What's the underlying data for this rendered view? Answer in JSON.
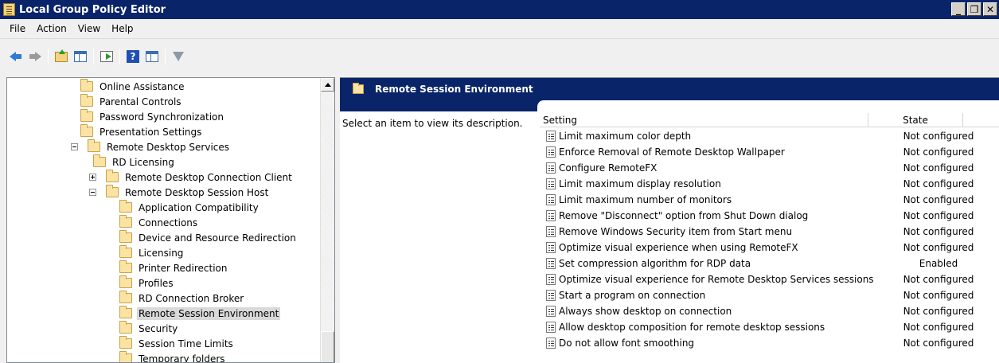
{
  "window": {
    "title": "Local Group Policy Editor",
    "controls": {
      "minimize": "_",
      "maximize": "ÿ",
      "close": "X"
    }
  },
  "menu": [
    "File",
    "Action",
    "View",
    "Help"
  ],
  "toolbar": {
    "buttons": [
      "back-icon",
      "forward-icon",
      "up-folder-icon",
      "show-hide-tree-icon",
      "export-list-icon",
      "help-icon",
      "properties-icon",
      "filter-icon"
    ]
  },
  "tree": {
    "items": [
      {
        "label": "Online Assistance",
        "level": 1
      },
      {
        "label": "Parental Controls",
        "level": 1
      },
      {
        "label": "Password Synchronization",
        "level": 1
      },
      {
        "label": "Presentation Settings",
        "level": 1
      },
      {
        "label": "Remote Desktop Services",
        "level": 1,
        "expander": "minus"
      },
      {
        "label": "RD Licensing",
        "level": 2
      },
      {
        "label": "Remote Desktop Connection Client",
        "level": 2,
        "expander": "plus"
      },
      {
        "label": "Remote Desktop Session Host",
        "level": 2,
        "expander": "minus"
      },
      {
        "label": "Application Compatibility",
        "level": 3
      },
      {
        "label": "Connections",
        "level": 3
      },
      {
        "label": "Device and Resource Redirection",
        "level": 3
      },
      {
        "label": "Licensing",
        "level": 3
      },
      {
        "label": "Printer Redirection",
        "level": 3
      },
      {
        "label": "Profiles",
        "level": 3
      },
      {
        "label": "RD Connection Broker",
        "level": 3
      },
      {
        "label": "Remote Session Environment",
        "level": 3,
        "selected": true
      },
      {
        "label": "Security",
        "level": 3
      },
      {
        "label": "Session Time Limits",
        "level": 3
      },
      {
        "label": "Temporary folders",
        "level": 3
      }
    ]
  },
  "details": {
    "header": "Remote Session Environment",
    "description": "Select an item to view its description.",
    "columns": {
      "setting": "Setting",
      "state": "State"
    },
    "settings": [
      {
        "name": "Limit maximum color depth",
        "state": "Not configured"
      },
      {
        "name": "Enforce Removal of Remote Desktop Wallpaper",
        "state": "Not configured"
      },
      {
        "name": "Configure RemoteFX",
        "state": "Not configured"
      },
      {
        "name": "Limit maximum display resolution",
        "state": "Not configured"
      },
      {
        "name": "Limit maximum number of monitors",
        "state": "Not configured"
      },
      {
        "name": "Remove \"Disconnect\" option from Shut Down dialog",
        "state": "Not configured"
      },
      {
        "name": "Remove Windows Security item from Start menu",
        "state": "Not configured"
      },
      {
        "name": "Optimize visual experience when using RemoteFX",
        "state": "Not configured"
      },
      {
        "name": "Set compression algorithm for RDP data",
        "state": "Enabled"
      },
      {
        "name": "Optimize visual experience for Remote Desktop Services sessions",
        "state": "Not configured"
      },
      {
        "name": "Start a program on connection",
        "state": "Not configured"
      },
      {
        "name": "Always show desktop on connection",
        "state": "Not configured"
      },
      {
        "name": "Allow desktop composition for remote desktop sessions",
        "state": "Not configured"
      },
      {
        "name": "Do not allow font smoothing",
        "state": "Not configured"
      }
    ]
  },
  "colors": {
    "titlebar": "#0a246a",
    "selection": "#d9d9d9",
    "folder": "#fbe4a3"
  }
}
